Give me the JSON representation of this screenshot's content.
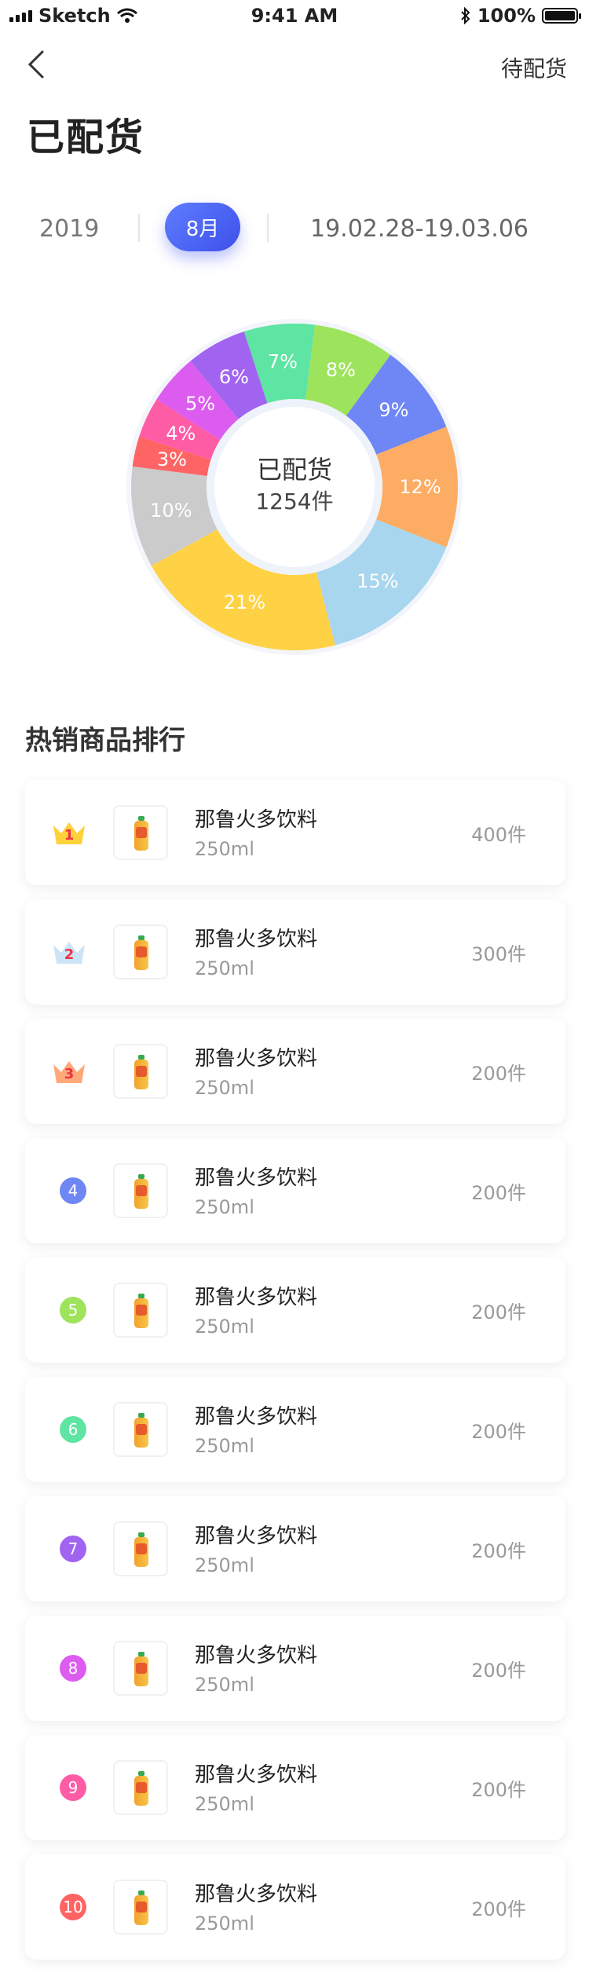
{
  "status_bar": {
    "carrier": "Sketch",
    "time": "9:41 AM",
    "battery": "100%"
  },
  "header": {
    "right_label": "待配货",
    "title": "已配货"
  },
  "period": {
    "year": "2019",
    "month": "8月",
    "range": "19.02.28-19.03.06"
  },
  "chart_data": {
    "type": "pie",
    "center_title": "已配货",
    "center_value": "1254件",
    "slices": [
      {
        "label": "7%",
        "value": 7,
        "color": "#5ee4a3"
      },
      {
        "label": "8%",
        "value": 8,
        "color": "#9ee35c"
      },
      {
        "label": "9%",
        "value": 9,
        "color": "#6f86f5"
      },
      {
        "label": "12%",
        "value": 12,
        "color": "#fcad63"
      },
      {
        "label": "15%",
        "value": 15,
        "color": "#a8d6ee"
      },
      {
        "label": "21%",
        "value": 21,
        "color": "#ffd246"
      },
      {
        "label": "10%",
        "value": 10,
        "color": "#cbcbcb"
      },
      {
        "label": "3%",
        "value": 3,
        "color": "#ff6464"
      },
      {
        "label": "4%",
        "value": 4,
        "color": "#ff5ca6"
      },
      {
        "label": "5%",
        "value": 5,
        "color": "#dc5cf0"
      },
      {
        "label": "6%",
        "value": 6,
        "color": "#a064f0"
      }
    ]
  },
  "ranking": {
    "title": "热销商品排行",
    "items": [
      {
        "rank": "1",
        "name": "那鲁火多饮料",
        "spec": "250ml",
        "count": "400件",
        "badge": "gold-crown",
        "color": "#ffd13a"
      },
      {
        "rank": "2",
        "name": "那鲁火多饮料",
        "spec": "250ml",
        "count": "300件",
        "badge": "silver-crown",
        "color": "#cde4f6"
      },
      {
        "rank": "3",
        "name": "那鲁火多饮料",
        "spec": "250ml",
        "count": "200件",
        "badge": "bronze-crown",
        "color": "#ffa87a"
      },
      {
        "rank": "4",
        "name": "那鲁火多饮料",
        "spec": "250ml",
        "count": "200件",
        "badge": "circle",
        "color": "#6f86f5"
      },
      {
        "rank": "5",
        "name": "那鲁火多饮料",
        "spec": "250ml",
        "count": "200件",
        "badge": "circle",
        "color": "#9ee35c"
      },
      {
        "rank": "6",
        "name": "那鲁火多饮料",
        "spec": "250ml",
        "count": "200件",
        "badge": "circle",
        "color": "#5ee4a3"
      },
      {
        "rank": "7",
        "name": "那鲁火多饮料",
        "spec": "250ml",
        "count": "200件",
        "badge": "circle",
        "color": "#a064f0"
      },
      {
        "rank": "8",
        "name": "那鲁火多饮料",
        "spec": "250ml",
        "count": "200件",
        "badge": "circle",
        "color": "#dc5cf0"
      },
      {
        "rank": "9",
        "name": "那鲁火多饮料",
        "spec": "250ml",
        "count": "200件",
        "badge": "circle",
        "color": "#ff5ca6"
      },
      {
        "rank": "10",
        "name": "那鲁火多饮料",
        "spec": "250ml",
        "count": "200件",
        "badge": "circle",
        "color": "#ff6464"
      }
    ]
  }
}
